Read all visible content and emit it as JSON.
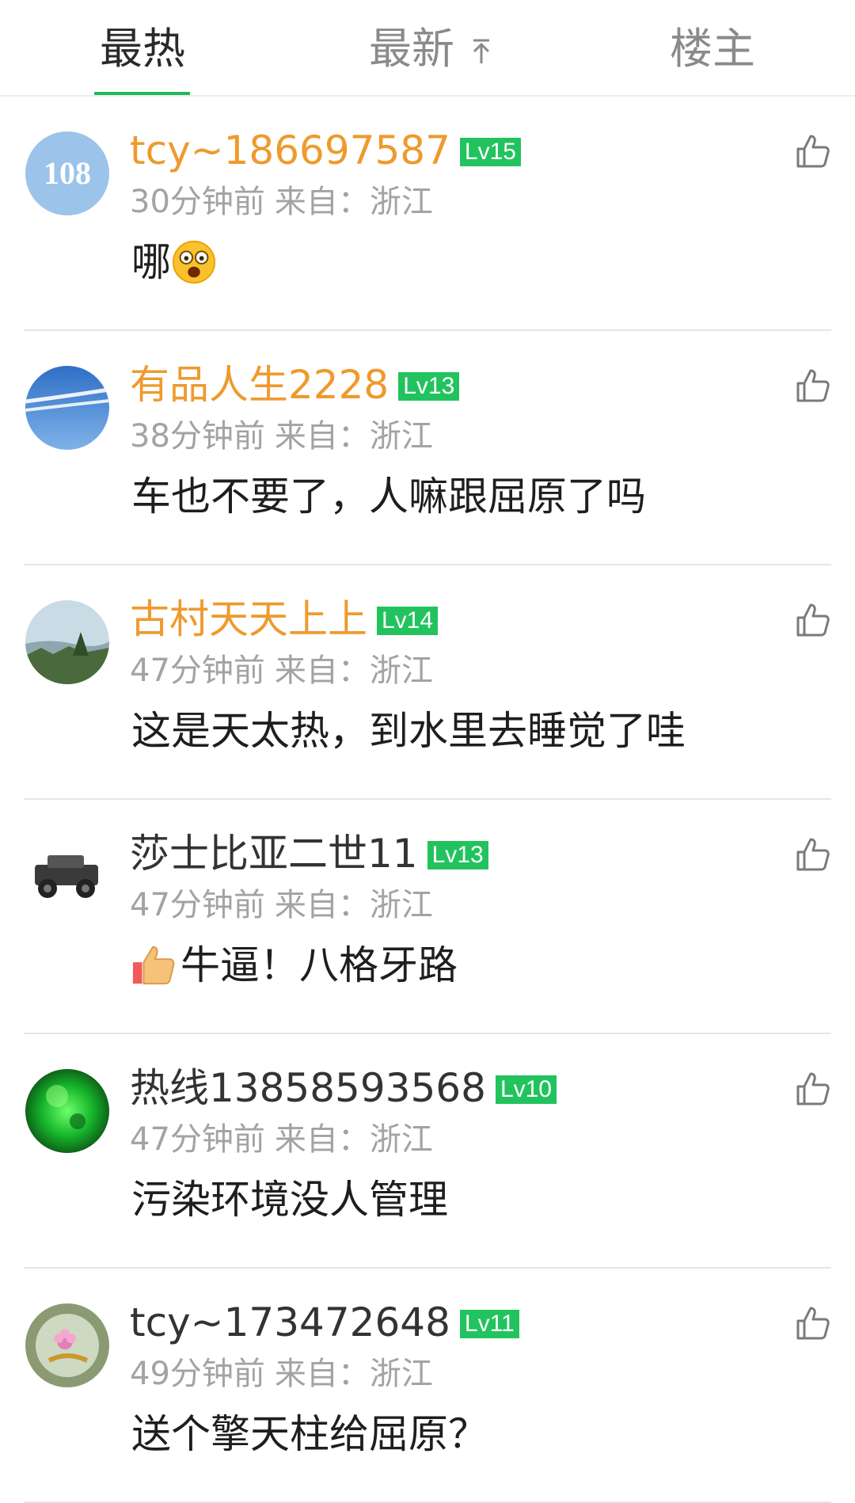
{
  "tabs": {
    "hot": "最热",
    "new": "最新",
    "op": "楼主"
  },
  "colors": {
    "accent": "#20b95a",
    "username_vip": "#ee9a2d",
    "level_badge": "#22c35e",
    "meta": "#a3a3a3"
  },
  "comments": [
    {
      "username": "tcy~186697587",
      "level": "Lv15",
      "time": "30分钟前",
      "location": "来自：浙江",
      "text": "哪",
      "emoji": "astonished-face-icon",
      "avatar_text": "108"
    },
    {
      "username": "有品人生2228",
      "level": "Lv13",
      "time": "38分钟前",
      "location": "来自：浙江",
      "text": "车也不要了，人嘛跟屈原了吗"
    },
    {
      "username": "古村天天上上",
      "level": "Lv14",
      "time": "47分钟前",
      "location": "来自：浙江",
      "text": "这是天太热，到水里去睡觉了哇"
    },
    {
      "username": "莎士比亚二世11",
      "level": "Lv13",
      "time": "47分钟前",
      "location": "来自：浙江",
      "text": "牛逼！八格牙路",
      "emoji": "thumbs-up-icon"
    },
    {
      "username": "热线13858593568",
      "level": "Lv10",
      "time": "47分钟前",
      "location": "来自：浙江",
      "text": "污染环境没人管理"
    },
    {
      "username": "tcy~173472648",
      "level": "Lv11",
      "time": "49分钟前",
      "location": "来自：浙江",
      "text": "送个擎天柱给屈原？"
    }
  ]
}
